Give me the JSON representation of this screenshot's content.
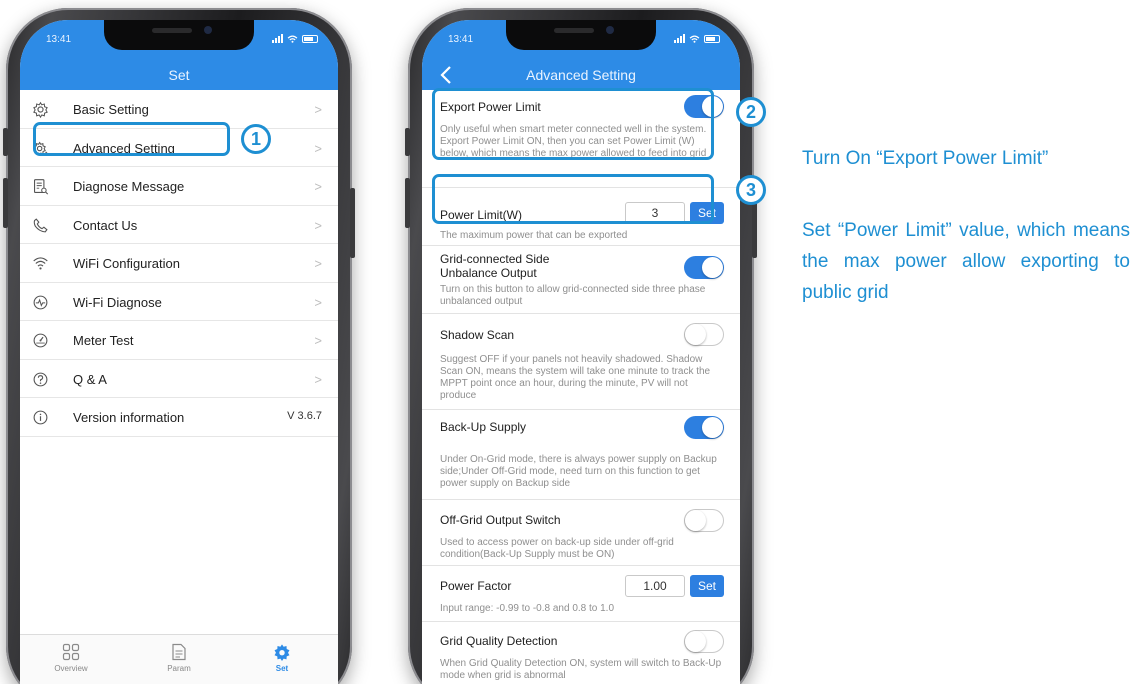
{
  "left_screen": {
    "status_time": "13:41",
    "title": "Set",
    "menu": [
      {
        "label": "Basic Setting",
        "icon": "gear-icon",
        "trail": ">"
      },
      {
        "label": "Advanced Setting",
        "icon": "advanced-gear-icon",
        "trail": ">"
      },
      {
        "label": "Diagnose Message",
        "icon": "diagnose-icon",
        "trail": ">"
      },
      {
        "label": "Contact Us",
        "icon": "phone-icon",
        "trail": ">"
      },
      {
        "label": "WiFi Configuration",
        "icon": "wifi-icon",
        "trail": ">"
      },
      {
        "label": "Wi-Fi Diagnose",
        "icon": "wifi-diagnose-icon",
        "trail": ">"
      },
      {
        "label": "Meter Test",
        "icon": "gauge-icon",
        "trail": ">"
      },
      {
        "label": "Q & A",
        "icon": "help-icon",
        "trail": ">"
      },
      {
        "label": "Version information",
        "icon": "info-icon",
        "trail": "V 3.6.7"
      }
    ],
    "tabs": [
      {
        "label": "Overview",
        "icon": "overview-grid-icon"
      },
      {
        "label": "Param",
        "icon": "param-document-icon"
      },
      {
        "label": "Set",
        "icon": "set-gear-icon",
        "active": true
      }
    ]
  },
  "right_screen": {
    "status_time": "13:41",
    "title": "Advanced Setting",
    "items": [
      {
        "title": "Export Power Limit",
        "toggle": "on",
        "desc": "Only useful when smart meter connected well in the system. Export Power Limit ON, then you can set Power Limit (W) below, which means the max power allowed to feed into grid"
      },
      {
        "title": "Power Limit(W)",
        "input_value": "3",
        "button": "Set",
        "desc": "The maximum power that can be exported"
      },
      {
        "title": "Grid-connected Side Unbalance Output",
        "toggle": "on",
        "desc": "Turn on this button to allow grid-connected side three phase unbalanced output"
      },
      {
        "title": "Shadow Scan",
        "toggle": "off",
        "desc": "Suggest OFF if your panels not heavily shadowed. Shadow Scan ON, means the system will take one minute to track the MPPT point once an hour, during the minute, PV will not produce"
      },
      {
        "title": "Back-Up Supply",
        "toggle": "on",
        "desc": "Under On-Grid mode, there is always power supply on Backup side;Under Off-Grid mode, need turn on this function to get power supply on Backup side"
      },
      {
        "title": "Off-Grid Output Switch",
        "toggle": "off",
        "desc": "Used to access power on back-up side under off-grid condition(Back-Up Supply must be ON)"
      },
      {
        "title": "Power Factor",
        "input_value": "1.00",
        "button": "Set",
        "desc": "Input range:  -0.99 to -0.8 and 0.8 to 1.0"
      },
      {
        "title": "Grid Quality Detection",
        "toggle": "off",
        "desc": "When Grid Quality Detection ON, system will switch to Back-Up mode when grid is abnormal"
      }
    ]
  },
  "annotations": {
    "step1": "1",
    "step2": "2",
    "step3": "3",
    "step2_text": "Turn On “Export Power Limit”",
    "step3_text": "Set “Power Limit” value, which means the max power allow exporting to public grid"
  },
  "colors": {
    "app_blue": "#2d8be6",
    "toggle_blue": "#2d7fe0",
    "annotation_blue": "#1e8fd2"
  }
}
